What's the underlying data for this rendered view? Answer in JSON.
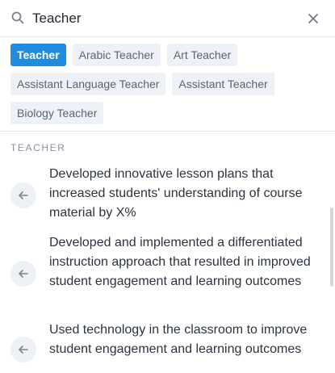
{
  "search": {
    "value": "Teacher",
    "icon": "search-icon",
    "clear_icon": "close-icon"
  },
  "chips": [
    {
      "label": "Teacher",
      "active": true
    },
    {
      "label": "Arabic Teacher",
      "active": false
    },
    {
      "label": "Art Teacher",
      "active": false
    },
    {
      "label": "Assistant Language Teacher",
      "active": false
    },
    {
      "label": "Assistant Teacher",
      "active": false
    },
    {
      "label": "Biology Teacher",
      "active": false
    }
  ],
  "section": {
    "heading": "TEACHER"
  },
  "suggestions": [
    {
      "text": "Developed innovative lesson plans that increased students' understanding of course material by X%",
      "icon": "arrow-left-icon"
    },
    {
      "text": "Developed and implemented a differentiated instruction approach that resulted in improved student engagement and learning outcomes",
      "icon": "arrow-left-icon"
    },
    {
      "text": "Used technology in the classroom to improve student engagement and learning outcomes",
      "icon": "arrow-left-icon"
    }
  ],
  "colors": {
    "accent": "#1f8ddf",
    "chip_bg": "#eef1f5",
    "text": "#2b3340",
    "muted": "#8a929c"
  }
}
